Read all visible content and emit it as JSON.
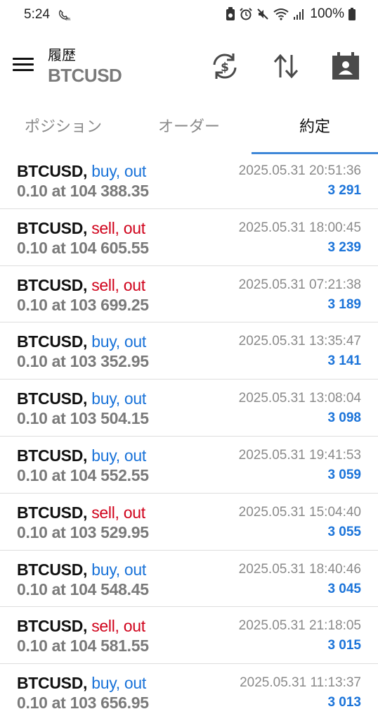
{
  "status_bar": {
    "time": "5:24",
    "battery": "100%"
  },
  "toolbar": {
    "title": "履歴",
    "symbol": "BTCUSD",
    "icons": [
      "menu-icon",
      "currency-exchange-icon",
      "sort-icon",
      "contact-calendar-icon"
    ]
  },
  "tabs": [
    {
      "label": "ポジション",
      "active": false
    },
    {
      "label": "オーダー",
      "active": false
    },
    {
      "label": "約定",
      "active": true
    }
  ],
  "colors": {
    "buy": "#1a73d9",
    "sell": "#d0021b",
    "profit": "#1a73d9",
    "accent": "#3f88d8"
  },
  "deals": [
    {
      "symbol": "BTCUSD,",
      "type": "buy, out",
      "side": "buy",
      "detail": "0.10 at 104 388.35",
      "time": "2025.05.31 20:51:36",
      "profit": "3 291"
    },
    {
      "symbol": "BTCUSD,",
      "type": "sell, out",
      "side": "sell",
      "detail": "0.10 at 104 605.55",
      "time": "2025.05.31 18:00:45",
      "profit": "3 239"
    },
    {
      "symbol": "BTCUSD,",
      "type": "sell, out",
      "side": "sell",
      "detail": "0.10 at 103 699.25",
      "time": "2025.05.31 07:21:38",
      "profit": "3 189"
    },
    {
      "symbol": "BTCUSD,",
      "type": "buy, out",
      "side": "buy",
      "detail": "0.10 at 103 352.95",
      "time": "2025.05.31 13:35:47",
      "profit": "3 141"
    },
    {
      "symbol": "BTCUSD,",
      "type": "buy, out",
      "side": "buy",
      "detail": "0.10 at 103 504.15",
      "time": "2025.05.31 13:08:04",
      "profit": "3 098"
    },
    {
      "symbol": "BTCUSD,",
      "type": "buy, out",
      "side": "buy",
      "detail": "0.10 at 104 552.55",
      "time": "2025.05.31 19:41:53",
      "profit": "3 059"
    },
    {
      "symbol": "BTCUSD,",
      "type": "sell, out",
      "side": "sell",
      "detail": "0.10 at 103 529.95",
      "time": "2025.05.31 15:04:40",
      "profit": "3 055"
    },
    {
      "symbol": "BTCUSD,",
      "type": "buy, out",
      "side": "buy",
      "detail": "0.10 at 104 548.45",
      "time": "2025.05.31 18:40:46",
      "profit": "3 045"
    },
    {
      "symbol": "BTCUSD,",
      "type": "sell, out",
      "side": "sell",
      "detail": "0.10 at 104 581.55",
      "time": "2025.05.31 21:18:05",
      "profit": "3 015"
    },
    {
      "symbol": "BTCUSD,",
      "type": "buy, out",
      "side": "buy",
      "detail": "0.10 at 103 656.95",
      "time": "2025.05.31 11:13:37",
      "profit": "3 013"
    }
  ]
}
